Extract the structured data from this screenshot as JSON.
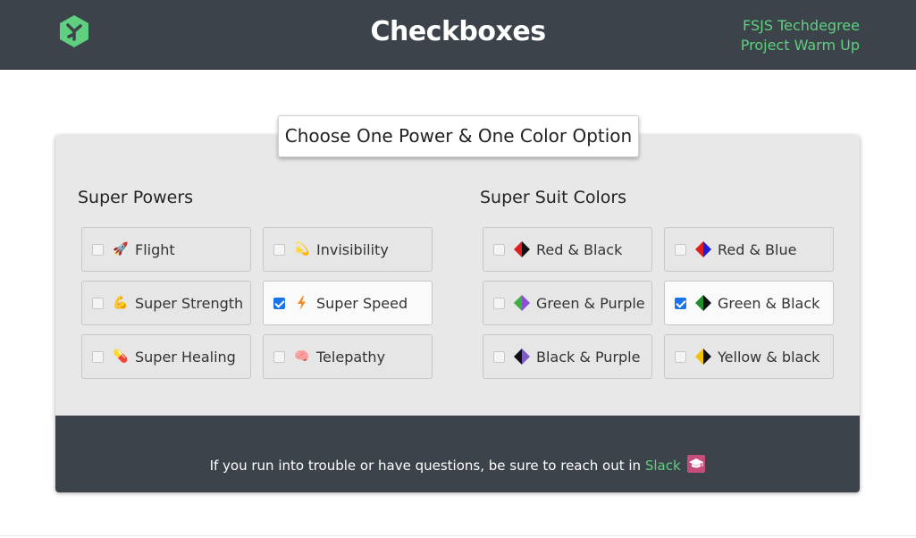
{
  "header": {
    "title": "Checkboxes",
    "subtitle_line1": "FSJS Techdegree",
    "subtitle_line2": "Project Warm Up",
    "logo_icon": "treehouse-logo-icon",
    "accent": "#5fcf80",
    "background": "#3d434b"
  },
  "form": {
    "legend": "Choose One Power & One Color Option",
    "powers": {
      "title": "Super Powers",
      "options": [
        {
          "label": "Flight",
          "icon": "rocket-icon",
          "checked": false
        },
        {
          "label": "Invisibility",
          "icon": "dizzy-icon",
          "checked": false
        },
        {
          "label": "Super Strength",
          "icon": "flexed-bicep-icon",
          "checked": false
        },
        {
          "label": "Super Speed",
          "icon": "lightning-icon",
          "checked": true
        },
        {
          "label": "Super Healing",
          "icon": "pill-icon",
          "checked": false
        },
        {
          "label": "Telepathy",
          "icon": "brain-icon",
          "checked": false
        }
      ]
    },
    "colors": {
      "title": "Super Suit Colors",
      "options": [
        {
          "label": "Red & Black",
          "colors": [
            "#e11d1d",
            "#111111"
          ],
          "checked": false
        },
        {
          "label": "Red & Blue",
          "colors": [
            "#e11d1d",
            "#1d1de1"
          ],
          "checked": false
        },
        {
          "label": "Green & Purple",
          "colors": [
            "#3cb043",
            "#8a4fd6"
          ],
          "checked": false
        },
        {
          "label": "Green & Black",
          "colors": [
            "#1f8f2f",
            "#111111"
          ],
          "checked": true
        },
        {
          "label": "Black & Purple",
          "colors": [
            "#111111",
            "#7d5bc4"
          ],
          "checked": false
        },
        {
          "label": "Yellow & black",
          "colors": [
            "#f2c200",
            "#111111"
          ],
          "checked": false
        }
      ]
    }
  },
  "footer": {
    "text": "If you run into trouble or have questions, be sure to reach out in",
    "link": "Slack",
    "link_icon": "graduation-cap-icon"
  }
}
